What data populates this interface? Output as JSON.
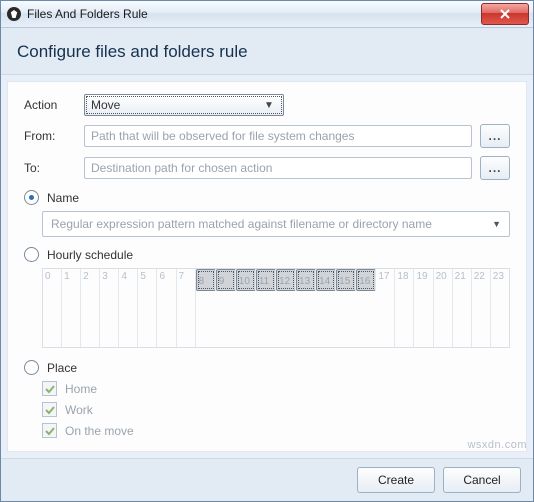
{
  "window": {
    "title": "Files And Folders Rule"
  },
  "header": {
    "title": "Configure files and folders rule"
  },
  "form": {
    "action_label": "Action",
    "action_value": "Move",
    "from_label": "From:",
    "from_placeholder": "Path that will be observed for file system changes",
    "to_label": "To:",
    "to_placeholder": "Destination path for chosen action",
    "browse_label": "..."
  },
  "options": {
    "name_label": "Name",
    "name_selected": true,
    "name_combo_placeholder": "Regular expression pattern matched against filename or directory name",
    "hourly_label": "Hourly schedule",
    "hourly_selected": false,
    "place_label": "Place",
    "place_selected": false
  },
  "schedule": {
    "hours": [
      "0",
      "1",
      "2",
      "3",
      "4",
      "5",
      "6",
      "7",
      "8",
      "9",
      "10",
      "11",
      "12",
      "13",
      "14",
      "15",
      "16",
      "17",
      "18",
      "19",
      "20",
      "21",
      "22",
      "23"
    ],
    "selected_start": 8,
    "selected_end": 16
  },
  "places": {
    "items": [
      {
        "label": "Home",
        "checked": true
      },
      {
        "label": "Work",
        "checked": true
      },
      {
        "label": "On the move",
        "checked": true
      }
    ]
  },
  "footer": {
    "create_label": "Create",
    "cancel_label": "Cancel"
  },
  "watermark": "wsxdn.com"
}
